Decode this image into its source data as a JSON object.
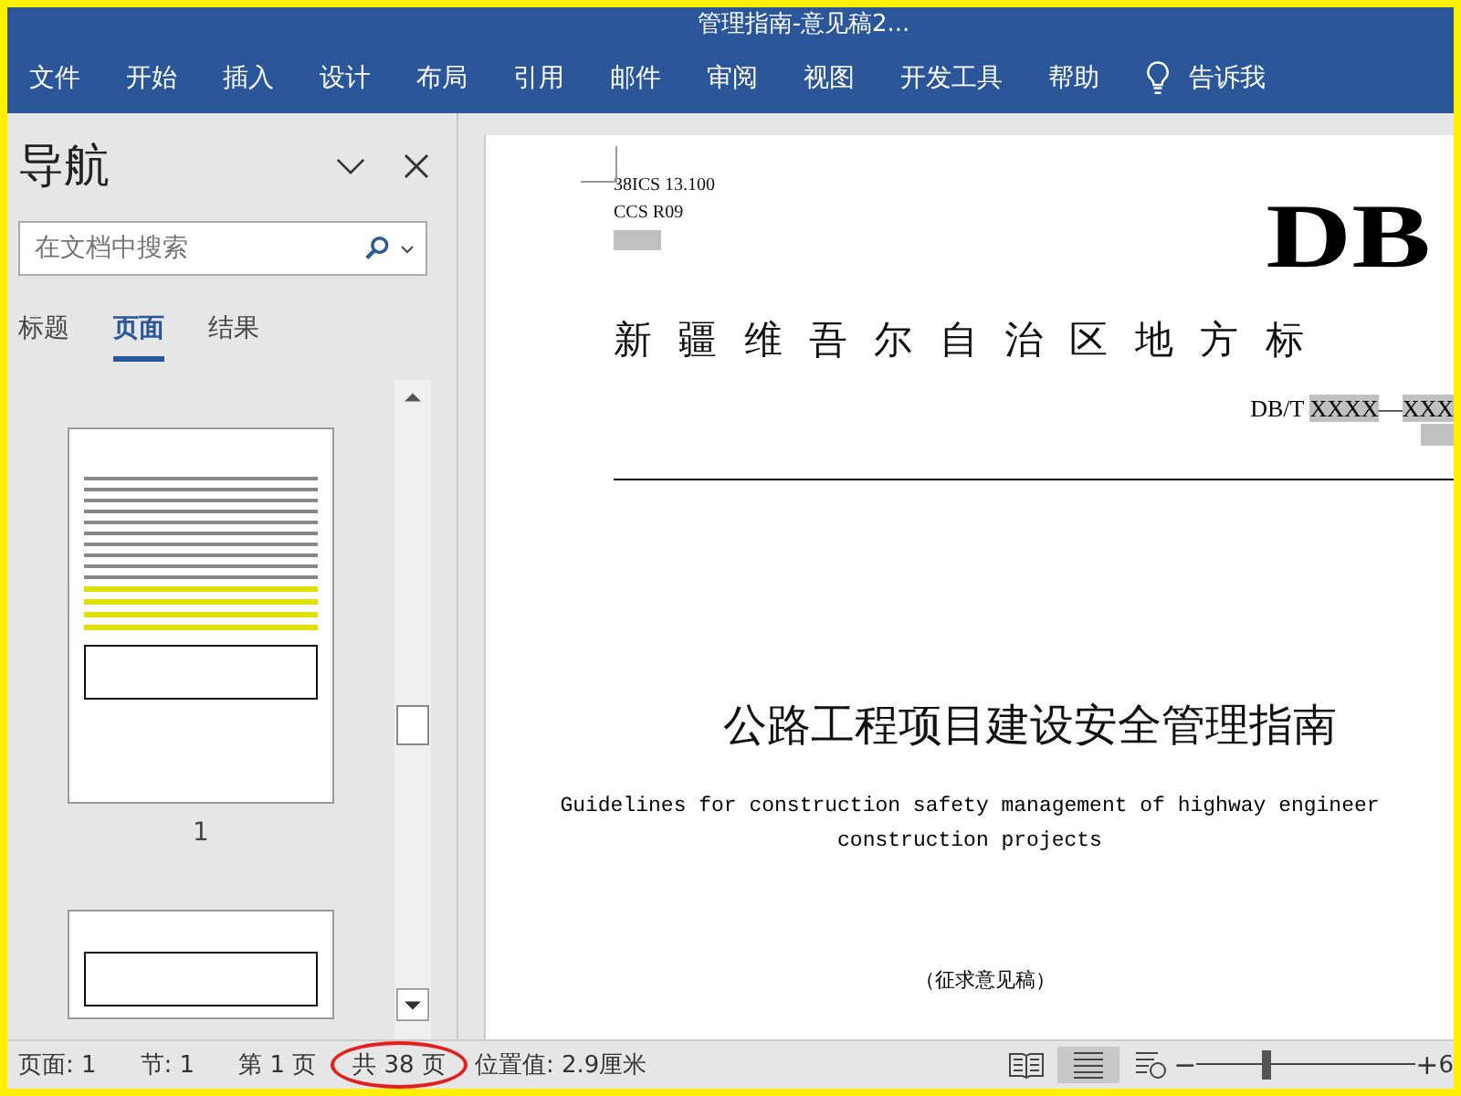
{
  "title_bar": {
    "title": "管理指南-意见稿2..."
  },
  "ribbon": {
    "tabs": [
      {
        "label": "文件"
      },
      {
        "label": "开始"
      },
      {
        "label": "插入"
      },
      {
        "label": "设计"
      },
      {
        "label": "布局"
      },
      {
        "label": "引用"
      },
      {
        "label": "邮件"
      },
      {
        "label": "审阅"
      },
      {
        "label": "视图"
      },
      {
        "label": "开发工具"
      },
      {
        "label": "帮助"
      }
    ],
    "tell_me": "告诉我"
  },
  "nav_pane": {
    "title": "导航",
    "search": {
      "placeholder": "在文档中搜索"
    },
    "tabs": [
      {
        "label": "标题",
        "selected": false
      },
      {
        "label": "页面",
        "selected": true
      },
      {
        "label": "结果",
        "selected": false
      }
    ],
    "thumbnails": [
      {
        "page_label": "1"
      }
    ]
  },
  "document": {
    "ics": "38ICS  13.100",
    "ccs": "CCS  R09",
    "mark": "DB",
    "region_title": "新 疆 维 吾 尔 自 治 区 地 方 标",
    "code": {
      "prefix": "DB/T",
      "number": "XXXX",
      "separator": "—",
      "year": "XXX"
    },
    "title": "公路工程项目建设安全管理指南",
    "english_lines": [
      "Guidelines for construction safety management of highway engineer",
      "construction projects"
    ],
    "draft_note": "（征求意见稿）"
  },
  "status_bar": {
    "items": [
      {
        "text": "页面: 1",
        "circled": false
      },
      {
        "text": "节: 1",
        "circled": false
      },
      {
        "text": "第 1 页",
        "circled": false
      },
      {
        "text": "共 38 页",
        "circled": true
      },
      {
        "text": "位置值: 2.9厘米",
        "circled": false
      }
    ],
    "views": [
      {
        "kind": "read",
        "selected": false
      },
      {
        "kind": "print",
        "selected": true
      },
      {
        "kind": "web",
        "selected": false
      }
    ],
    "zoom": {
      "minus": "−",
      "plus": "+",
      "level": 0.3,
      "reading": "6"
    }
  }
}
